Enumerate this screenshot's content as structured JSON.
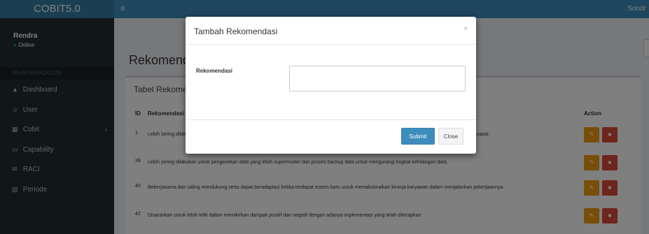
{
  "header": {
    "logo": "COBIT5.0",
    "toggle_icon": "bars-icon",
    "user": "Sondr"
  },
  "sidebar": {
    "user_name": "Rendra",
    "status_dot": "●",
    "status": "Online",
    "section_label": "MAIN NAVIGATION",
    "items": [
      {
        "label": "Dashboard",
        "icon": "dashboard-icon",
        "glyph": "▲"
      },
      {
        "label": "User",
        "icon": "users-icon",
        "glyph": "☺"
      },
      {
        "label": "Cobit",
        "icon": "table-icon",
        "glyph": "▦",
        "chevron": "‹"
      },
      {
        "label": "Capability",
        "icon": "chart-icon",
        "glyph": "▭"
      },
      {
        "label": "RACI",
        "icon": "envelope-icon",
        "glyph": "✉"
      },
      {
        "label": "Periode",
        "icon": "calendar-icon",
        "glyph": "▤"
      }
    ]
  },
  "content": {
    "page_title": "Rekomendasi",
    "box_title": "Tabel Rekomendasi",
    "columns": {
      "id": "ID",
      "rekomendasi": "Rekomendasi",
      "action": "Action"
    },
    "rows": [
      {
        "id": "1",
        "text": "Lebih sering dilakukan pelatihan bagi para pegawai untuk membantu pencapaian kinerja yang lebih efektif dan efisien agar tujuan perusahaan dapat tercapai."
      },
      {
        "id": "39",
        "text": "Lebih sering dilakukan untuk pengecekan data yang lebih supermulain dan proses backup data untuk mengurangi tingkat kehilangan data."
      },
      {
        "id": "40",
        "text": "Bekerjasama dan saling mendukung serta dapat beradaptasi ketika terdapat sistem baru untuk memaksimalkan kinerja karyawan dalam menjalankan pekerjaannya."
      },
      {
        "id": "42",
        "text": "Disarankan untuk lebih teliti dalam memikirkan dampak positif dan negatif dengan adanya implementasi yang telah diterapkan"
      }
    ],
    "edit_glyph": "✎",
    "delete_glyph": "■"
  },
  "modal": {
    "title": "Tambah Rekomendasi",
    "close_glyph": "×",
    "label": "Rekomendasi",
    "input_value": "",
    "submit_label": "Submit",
    "close_label": "Close"
  },
  "colors": {
    "primary": "#3c8dbc",
    "sidebar": "#222d32",
    "warning": "#f39c12",
    "danger": "#dd4b39"
  }
}
